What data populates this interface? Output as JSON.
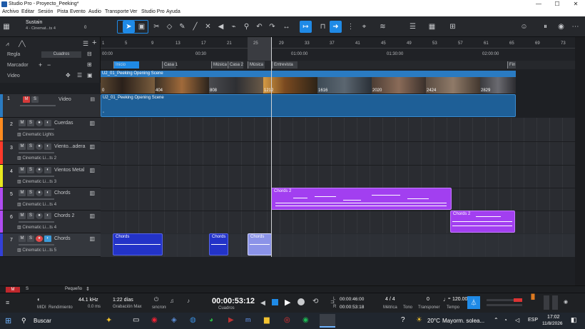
{
  "window": {
    "title": "Studio Pro - Proyecto_Peeking*",
    "min": "—",
    "max": "☐",
    "close": "✕"
  },
  "menu": [
    "Archivo",
    "Editar",
    "Sesión",
    "Pista",
    "Evento",
    "Audio",
    "Transporte",
    "Ver",
    "Studio Pro",
    "Ayuda"
  ],
  "toolbar": {
    "preset": "Sustain",
    "preset_sub": "4 - Cinemat...ts 4",
    "preset_val": "0"
  },
  "lefthead": {
    "regla": "Regla",
    "regla_value": "Cuadros",
    "marcador": "Marcador",
    "video": "Video"
  },
  "ruler": {
    "bars": [
      "1",
      "5",
      "9",
      "13",
      "17",
      "21",
      "25",
      "29",
      "33",
      "37",
      "41",
      "45",
      "49",
      "53",
      "57",
      "61",
      "65",
      "69",
      "73"
    ],
    "times": [
      "00:00",
      "00:30",
      "01:00:00",
      "01:30:00",
      "02:00:00"
    ],
    "top_left": "0"
  },
  "markers": [
    "Inicio",
    "Casa 1",
    "Música",
    "Casa 2",
    "Música",
    "Entrevista",
    "Fin"
  ],
  "video": {
    "clip_label": "U2_01_Peeking Opening Scene",
    "frames": [
      "0",
      "404",
      "808",
      "1212",
      "1616",
      "2020",
      "2424",
      "2829"
    ]
  },
  "video_track": {
    "num": "1",
    "name": "Video",
    "m": "M",
    "s": "S",
    "clip": "U2_01_Peeking Opening Scene"
  },
  "tracks": [
    {
      "num": "2",
      "name": "Cuerdas",
      "inst": "Cinematic Lights",
      "m": "M",
      "s": "S",
      "color": "#ff8b1f"
    },
    {
      "num": "3",
      "name": "Viento...adera",
      "inst": "Cinematic Li...ts 2",
      "m": "M",
      "s": "S",
      "color": "#ff3a2a"
    },
    {
      "num": "4",
      "name": "Vientos Metal",
      "inst": "Cinematic Li...ts 3",
      "m": "M",
      "s": "S",
      "color": "#e8e81e"
    },
    {
      "num": "5",
      "name": "Chords",
      "inst": "Cinematic Li...ts 4",
      "m": "M",
      "s": "S",
      "color": "#b04cf2"
    },
    {
      "num": "6",
      "name": "Chords 2",
      "inst": "Cinematic Li...ts 4",
      "m": "M",
      "s": "S",
      "color": "#b04cf2"
    },
    {
      "num": "7",
      "name": "Chords",
      "inst": "Cinematic Li...ts 5",
      "m": "M",
      "s": "S",
      "color": "#3340d8"
    }
  ],
  "clips": [
    {
      "label": "Chords 2",
      "track": 5
    },
    {
      "label": "Chords 2",
      "track": 6
    },
    {
      "label": "Chords",
      "track": 7
    },
    {
      "label": "Chords",
      "track": 7
    },
    {
      "label": "Chords",
      "track": 7
    }
  ],
  "mixstrip": {
    "m": "M",
    "s": "S",
    "size": "Pequeño"
  },
  "transport": {
    "midi": "MIDI",
    "rend": "Rendimiento",
    "rate": "44.1 kHz",
    "lat": "0.0 ms",
    "rec_days": "1:22 días",
    "rec_label": "Grabación Max",
    "sync": "sincronizar",
    "time": "00:00:53:12",
    "time_unit": "Cuadros",
    "loop_l": "00:00:46:00",
    "loop_r": "00:00:53:18",
    "l": "L",
    "r": "R",
    "metric": "4 / 4",
    "metric_label": "Métrica",
    "tone": "Tono",
    "trans": "0",
    "trans_label": "Transponer",
    "tempo": "120.00",
    "tempo_label": "Tempo"
  },
  "taskbar": {
    "search": "Buscar",
    "weather": "20°C",
    "weather_desc": "Mayorm. solea...",
    "lang": "ESP",
    "time": "17:02",
    "date": "11/8/2026"
  }
}
